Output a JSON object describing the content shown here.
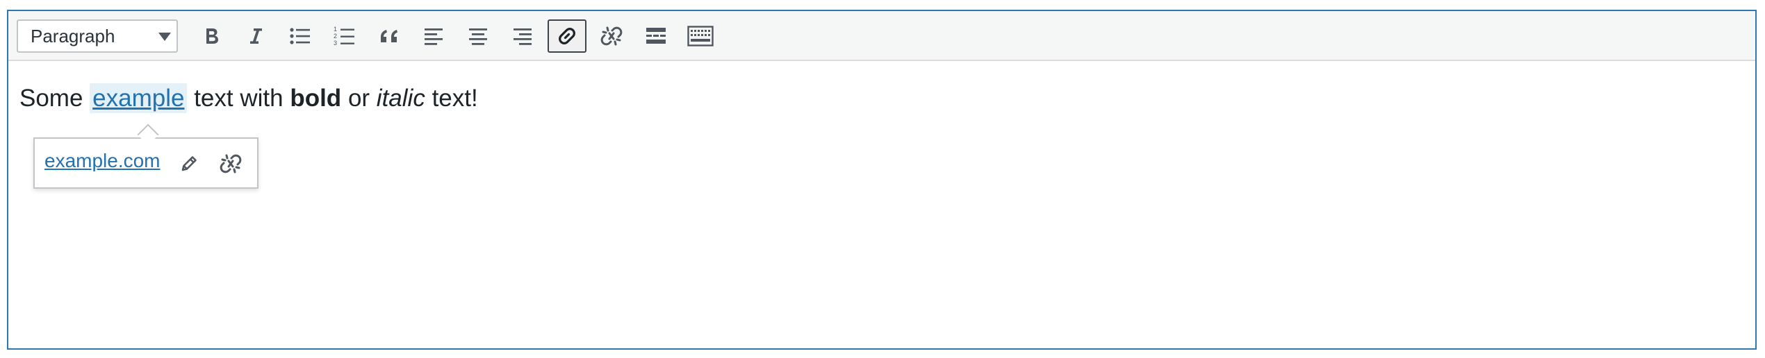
{
  "toolbar": {
    "format_select": {
      "value": "Paragraph"
    },
    "buttons": [
      {
        "name": "bold-button",
        "icon": "bold-icon",
        "active": false
      },
      {
        "name": "italic-button",
        "icon": "italic-icon",
        "active": false
      },
      {
        "name": "bulleted-list-button",
        "icon": "bulleted-list-icon",
        "active": false
      },
      {
        "name": "numbered-list-button",
        "icon": "numbered-list-icon",
        "active": false
      },
      {
        "name": "blockquote-button",
        "icon": "blockquote-icon",
        "active": false
      },
      {
        "name": "align-left-button",
        "icon": "align-left-icon",
        "active": false
      },
      {
        "name": "align-center-button",
        "icon": "align-center-icon",
        "active": false
      },
      {
        "name": "align-right-button",
        "icon": "align-right-icon",
        "active": false
      },
      {
        "name": "insert-link-button",
        "icon": "link-icon",
        "active": true
      },
      {
        "name": "remove-link-button",
        "icon": "unlink-icon",
        "active": false
      },
      {
        "name": "read-more-button",
        "icon": "read-more-icon",
        "active": false
      },
      {
        "name": "toolbar-toggle-button",
        "icon": "keyboard-icon",
        "active": false
      }
    ]
  },
  "content": {
    "text_before_link": "Some",
    "link_text": "example",
    "text_after_link": "text with",
    "bold_text": "bold",
    "text_between": "or",
    "italic_text": "italic",
    "text_end": "text!"
  },
  "link_popup": {
    "url": "example.com",
    "edit_icon": "pencil-icon",
    "unlink_icon": "unlink-icon"
  },
  "colors": {
    "editor_border": "#2e77b3",
    "link": "#2271b1",
    "link_highlight": "#e5f1f9",
    "toolbar_bg": "#f5f6f6",
    "icon": "#50575e"
  }
}
